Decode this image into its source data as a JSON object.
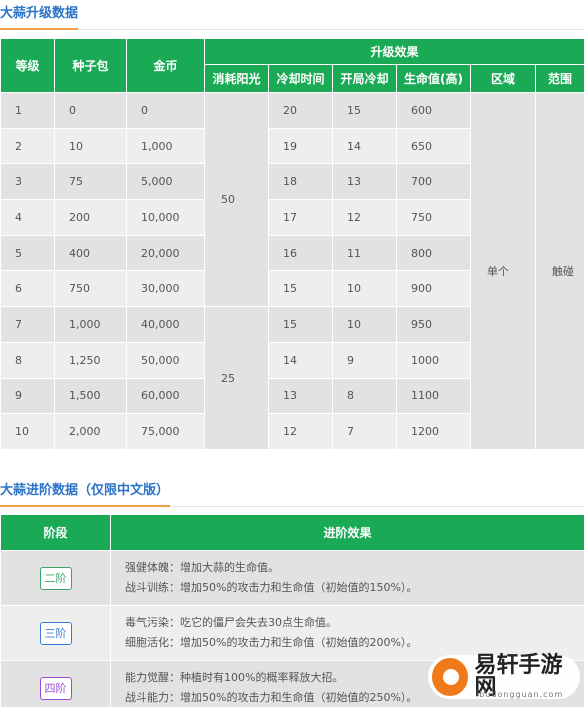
{
  "section1": {
    "title": "大蒜升级数据",
    "headers": {
      "level": "等级",
      "seeds": "种子包",
      "gold": "金币",
      "upgrade_effect": "升级效果",
      "sun_cost": "消耗阳光",
      "cooldown": "冷却时间",
      "start_cooldown": "开局冷却",
      "hp": "生命值(高)",
      "area": "区域",
      "range": "范围"
    },
    "rows": [
      {
        "level": "1",
        "seeds": "0",
        "gold": "0",
        "cooldown": "20",
        "start_cooldown": "15",
        "hp": "600"
      },
      {
        "level": "2",
        "seeds": "10",
        "gold": "1,000",
        "cooldown": "19",
        "start_cooldown": "14",
        "hp": "650"
      },
      {
        "level": "3",
        "seeds": "75",
        "gold": "5,000",
        "cooldown": "18",
        "start_cooldown": "13",
        "hp": "700"
      },
      {
        "level": "4",
        "seeds": "200",
        "gold": "10,000",
        "cooldown": "17",
        "start_cooldown": "12",
        "hp": "750"
      },
      {
        "level": "5",
        "seeds": "400",
        "gold": "20,000",
        "cooldown": "16",
        "start_cooldown": "11",
        "hp": "800"
      },
      {
        "level": "6",
        "seeds": "750",
        "gold": "30,000",
        "cooldown": "15",
        "start_cooldown": "10",
        "hp": "900"
      },
      {
        "level": "7",
        "seeds": "1,000",
        "gold": "40,000",
        "cooldown": "15",
        "start_cooldown": "10",
        "hp": "950"
      },
      {
        "level": "8",
        "seeds": "1,250",
        "gold": "50,000",
        "cooldown": "14",
        "start_cooldown": "9",
        "hp": "1000"
      },
      {
        "level": "9",
        "seeds": "1,500",
        "gold": "60,000",
        "cooldown": "13",
        "start_cooldown": "8",
        "hp": "1100"
      },
      {
        "level": "10",
        "seeds": "2,000",
        "gold": "75,000",
        "cooldown": "12",
        "start_cooldown": "7",
        "hp": "1200"
      }
    ],
    "sun_cost_group1": "50",
    "sun_cost_group2": "25",
    "area_value": "单个",
    "range_value": "触碰"
  },
  "section2": {
    "title": "大蒜进阶数据（仅限中文版）",
    "headers": {
      "stage": "阶段",
      "effect": "进阶效果"
    },
    "rows": [
      {
        "stage": "二阶",
        "color": "#3aa66a",
        "line1": "强健体魄：增加大蒜的生命值。",
        "line2": "战斗训练：增加50%的攻击力和生命值（初始值的150%）。"
      },
      {
        "stage": "三阶",
        "color": "#3a78d6",
        "line1": "毒气污染：吃它的僵尸会失去30点生命值。",
        "line2": "细胞活化：增加50%的攻击力和生命值（初始值的200%）。"
      },
      {
        "stage": "四阶",
        "color": "#9a4cd2",
        "line1": "能力觉醒：种植时有100%的概率释放大招。",
        "line2": "战斗能力：增加50%的攻击力和生命值（初始值的250%）。"
      }
    ]
  },
  "watermark": {
    "name": "易轩手游网",
    "url": "ibudongguan.com"
  },
  "colors": {
    "header_green": "#1aaa55",
    "title_blue": "#2a73c8",
    "underline_orange": "#f0a24a"
  }
}
